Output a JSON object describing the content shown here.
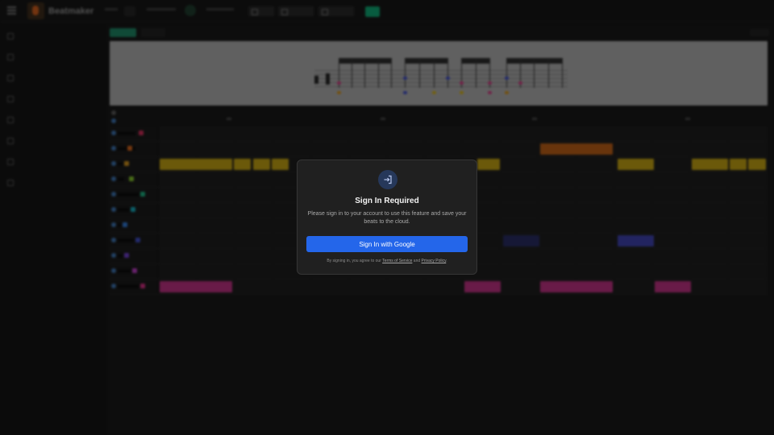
{
  "app": {
    "brand": "Beatmaker"
  },
  "modal": {
    "title": "Sign In Required",
    "body": "Please sign in to your account to use this feature and save your beats to the cloud.",
    "google_button": "Sign In with Google",
    "legal_prefix": "By signing in, you agree to our",
    "terms_link": "Terms of Service",
    "legal_and": "and",
    "privacy_link": "Privacy Policy",
    "legal_suffix": "."
  },
  "colors": {
    "accent_green": "#0f9f6e",
    "primary_button": "#2466ea",
    "track_yellow": "#b99a12",
    "track_orange": "#b35a16",
    "track_pink": "#b52f7c",
    "track_blue": "#3b3fa6"
  },
  "icons": {
    "modal": "sign-in-icon",
    "menu": "menu-icon"
  }
}
